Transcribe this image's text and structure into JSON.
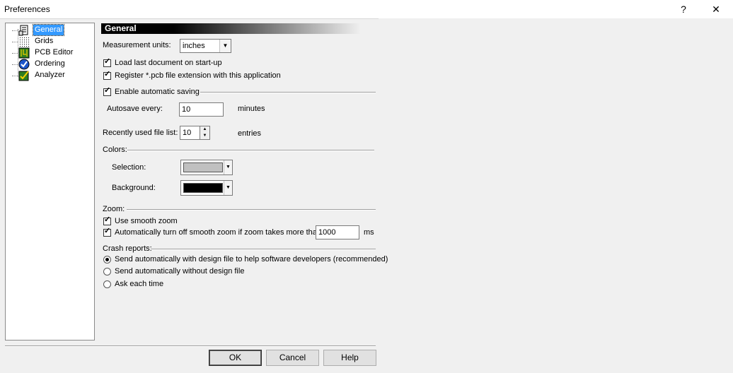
{
  "window": {
    "title": "Preferences",
    "help_glyph": "?",
    "close_glyph": "✕"
  },
  "tree": {
    "items": [
      {
        "label": "General",
        "icon": "general-page-icon",
        "selected": true
      },
      {
        "label": "Grids",
        "icon": "grid-dots-icon",
        "selected": false
      },
      {
        "label": "PCB Editor",
        "icon": "pcb-board-icon",
        "selected": false
      },
      {
        "label": "Ordering",
        "icon": "ordering-check-icon",
        "selected": false
      },
      {
        "label": "Analyzer",
        "icon": "analyzer-check-icon",
        "selected": false
      }
    ]
  },
  "general": {
    "header": "General",
    "measurement_units_label": "Measurement units:",
    "measurement_units_value": "inches",
    "load_last_label": "Load last document on start-up",
    "load_last_checked": true,
    "register_ext_label": "Register *.pcb file extension with this application",
    "register_ext_checked": true,
    "autosave_label": "Enable automatic saving",
    "autosave_checked": true,
    "autosave_every_label": "Autosave every:",
    "autosave_every_value": "10",
    "autosave_units": "minutes",
    "recent_files_label": "Recently used file list:",
    "recent_files_value": "10",
    "recent_files_units": "entries",
    "colors_label": "Colors:",
    "selection_label": "Selection:",
    "selection_color": "#c0c0c0",
    "background_label": "Background:",
    "background_color": "#000000",
    "zoom_label": "Zoom:",
    "smooth_zoom_label": "Use smooth zoom",
    "smooth_zoom_checked": true,
    "auto_off_label": "Automatically turn off smooth zoom if zoom takes more than",
    "auto_off_checked": true,
    "auto_off_value": "1000",
    "auto_off_units": "ms",
    "crash_label": "Crash reports:",
    "crash_options": [
      {
        "label": "Send automatically with design file to help software developers (recommended)",
        "selected": true
      },
      {
        "label": "Send automatically without design file",
        "selected": false
      },
      {
        "label": "Ask each time",
        "selected": false
      }
    ]
  },
  "buttons": {
    "ok": "OK",
    "cancel": "Cancel",
    "help": "Help"
  }
}
